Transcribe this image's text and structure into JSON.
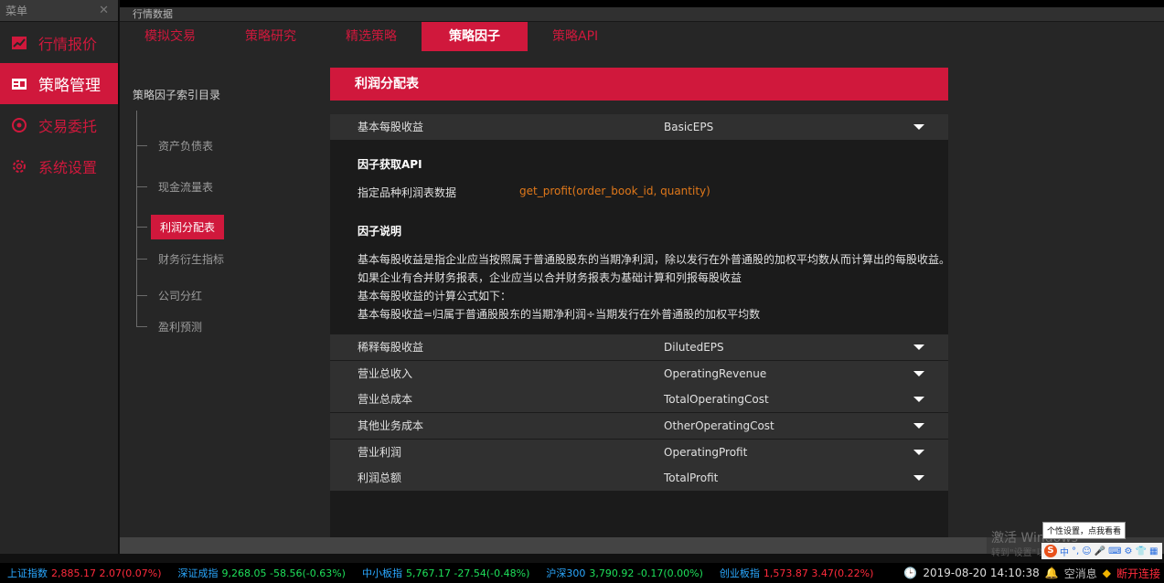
{
  "left_panel": {
    "header": "菜单",
    "close_icon": "close-icon",
    "items": [
      {
        "label": "行情报价",
        "icon": "chart-icon"
      },
      {
        "label": "策略管理",
        "icon": "card-icon"
      },
      {
        "label": "交易委托",
        "icon": "coin-icon"
      },
      {
        "label": "系统设置",
        "icon": "gear-icon"
      }
    ],
    "active_index": 1
  },
  "main_header": "行情数据",
  "nav_tabs": [
    "模拟交易",
    "策略研究",
    "精选策略",
    "策略因子",
    "策略API"
  ],
  "active_tab": "策略因子",
  "tree": {
    "title": "策略因子索引目录",
    "items": [
      "资产负债表",
      "现金流量表",
      "利润分配表",
      "财务衍生指标",
      "公司分红",
      "盈利预测"
    ],
    "active_index": 2
  },
  "panel": {
    "title": "利润分配表",
    "first_row": {
      "name": "基本每股收益",
      "code": "BasicEPS"
    },
    "api_heading": "因子获取API",
    "api_label": "指定品种利润表数据",
    "api_value": "get_profit(order_book_id, quantity)",
    "desc_heading": "因子说明",
    "desc_lines": [
      "基本每股收益是指企业应当按照属于普通股股东的当期净利润，除以发行在外普通股的加权平均数从而计算出的每股收益。",
      "如果企业有合并财务报表，企业应当以合并财务报表为基础计算和列报每股收益",
      "基本每股收益的计算公式如下：",
      "基本每股收益=归属于普通股股东的当期净利润÷当期发行在外普通股的加权平均数"
    ],
    "rows": [
      {
        "name": "稀释每股收益",
        "code": "DilutedEPS"
      },
      {
        "name": "营业总收入",
        "code": "OperatingRevenue"
      },
      {
        "name": "营业总成本",
        "code": "TotalOperatingCost"
      },
      {
        "name": "其他业务成本",
        "code": "OtherOperatingCost"
      },
      {
        "name": "营业利润",
        "code": "OperatingProfit"
      },
      {
        "name": "利润总额",
        "code": "TotalProfit"
      }
    ]
  },
  "status_indices": [
    {
      "name": "上证指数",
      "value": "2,885.17 2.07(0.07%)",
      "dir": "up"
    },
    {
      "name": "深证成指",
      "value": "9,268.05 -58.56(-0.63%)",
      "dir": "down"
    },
    {
      "name": "中小板指",
      "value": "5,767.17 -27.54(-0.48%)",
      "dir": "down"
    },
    {
      "name": "沪深300",
      "value": "3,790.92 -0.17(0.00%)",
      "dir": "down"
    },
    {
      "name": "创业板指",
      "value": "1,573.87 3.47(0.22%)",
      "dir": "up"
    }
  ],
  "bottom_status": {
    "clock_label": "2019-08-20 14:10:38",
    "messages_label": "空消息",
    "connection_label": "断开连接"
  },
  "overlay": {
    "watermark": "激活 Windows",
    "watermark_sub": "转到\"设置\"以激活 Windows。",
    "tooltip": "个性设置，点我看看",
    "ime_mode": "中"
  },
  "colors": {
    "accent": "#d0183c",
    "orange": "#e0781a",
    "up": "#ff2b3c",
    "down": "#1ee05a",
    "index_name": "#2aa8ff"
  }
}
